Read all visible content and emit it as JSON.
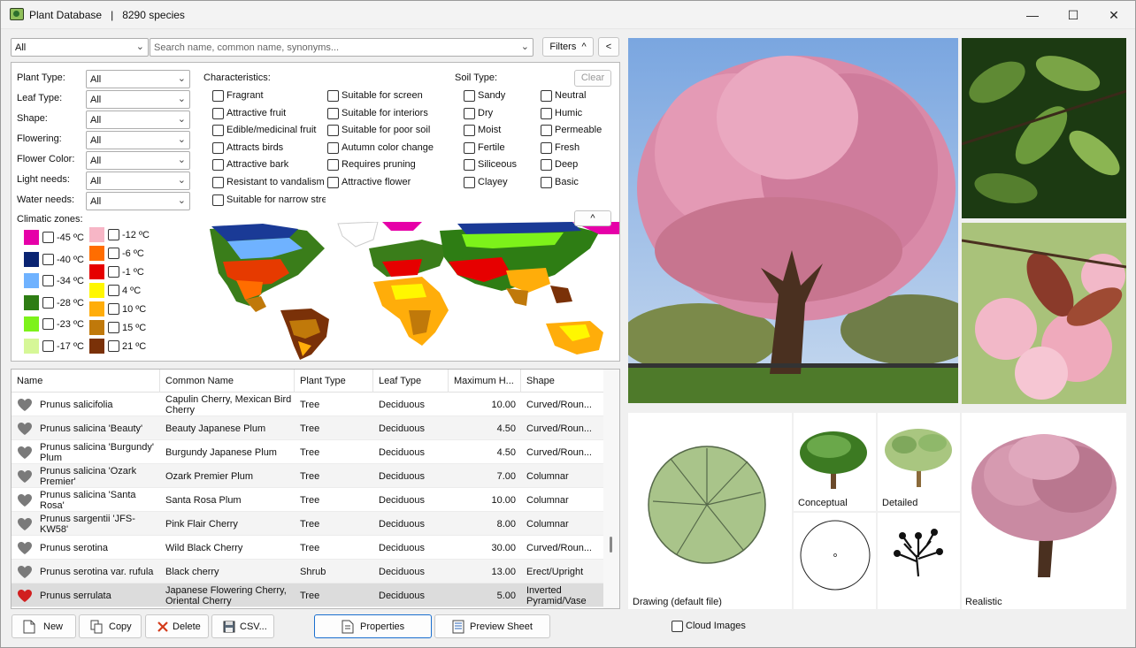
{
  "window": {
    "title": "Plant Database",
    "species_count": "8290 species",
    "minimize": "—",
    "maximize": "☐",
    "close": "✕"
  },
  "topbar": {
    "category_value": "All",
    "search_placeholder": "Search name, common name, synonyms...",
    "filters_label": "Filters",
    "filters_chevron": "^",
    "collapse_label": "<"
  },
  "filters": {
    "fields": [
      {
        "label": "Plant Type:",
        "value": "All"
      },
      {
        "label": "Leaf Type:",
        "value": "All"
      },
      {
        "label": "Shape:",
        "value": "All"
      },
      {
        "label": "Flowering:",
        "value": "All"
      },
      {
        "label": "Flower Color:",
        "value": "All"
      },
      {
        "label": "Light needs:",
        "value": "All"
      },
      {
        "label": "Water needs:",
        "value": "All"
      }
    ],
    "characteristics_title": "Characteristics:",
    "characteristics_col1": [
      "Fragrant",
      "Attractive fruit",
      "Edible/medicinal fruit",
      "Attracts birds",
      "Attractive bark",
      "Resistant to vandalism",
      "Suitable for narrow stre"
    ],
    "characteristics_col2": [
      "Suitable for screen",
      "Suitable for interiors",
      "Suitable for poor soil",
      "Autumn color change",
      "Requires pruning",
      "Attractive flower"
    ],
    "soil_title": "Soil Type:",
    "soil_col1": [
      "Sandy",
      "Dry",
      "Moist",
      "Fertile",
      "Siliceous",
      "Clayey"
    ],
    "soil_col2": [
      "Neutral",
      "Humic",
      "Permeable",
      "Fresh",
      "Deep",
      "Basic"
    ],
    "clear_label": "Clear",
    "climatic_title": "Climatic zones:",
    "collapse_map": "^",
    "zones_left": [
      {
        "label": "-45 ºC",
        "color": "#e600a8"
      },
      {
        "label": "-40 ºC",
        "color": "#0a2472"
      },
      {
        "label": "-34 ºC",
        "color": "#6fb2ff"
      },
      {
        "label": "-28 ºC",
        "color": "#2e7d14"
      },
      {
        "label": "-23 ºC",
        "color": "#7df21a"
      },
      {
        "label": "-17 ºC",
        "color": "#d6f797"
      }
    ],
    "zones_right": [
      {
        "label": "-12 ºC",
        "color": "#f7b6c6"
      },
      {
        "label": "-6 ºC",
        "color": "#ff6d00"
      },
      {
        "label": "-1 ºC",
        "color": "#e60000"
      },
      {
        "label": "4 ºC",
        "color": "#fff700"
      },
      {
        "label": "10 ºC",
        "color": "#ffad0a"
      },
      {
        "label": "15 ºC",
        "color": "#c0790a"
      },
      {
        "label": "21 ºC",
        "color": "#7a3108"
      }
    ]
  },
  "table": {
    "columns": [
      "Name",
      "Common Name",
      "Plant Type",
      "Leaf Type",
      "Maximum H...",
      "Shape"
    ],
    "rows": [
      {
        "name": "Prunus salicifolia",
        "common": "Capulin Cherry, Mexican Bird Cherry",
        "type": "Tree",
        "leaf": "Deciduous",
        "height": "10.00",
        "shape": "Curved/Roun...",
        "favorite": false
      },
      {
        "name": "Prunus salicina 'Beauty'",
        "common": "Beauty Japanese Plum",
        "type": "Tree",
        "leaf": "Deciduous",
        "height": "4.50",
        "shape": "Curved/Roun...",
        "favorite": false
      },
      {
        "name": "Prunus salicina 'Burgundy' Plum",
        "common": "Burgundy Japanese Plum",
        "type": "Tree",
        "leaf": "Deciduous",
        "height": "4.50",
        "shape": "Curved/Roun...",
        "favorite": false
      },
      {
        "name": "Prunus salicina 'Ozark Premier'",
        "common": "Ozark Premier Plum",
        "type": "Tree",
        "leaf": "Deciduous",
        "height": "7.00",
        "shape": "Columnar",
        "favorite": false
      },
      {
        "name": "Prunus salicina 'Santa Rosa'",
        "common": "Santa Rosa Plum",
        "type": "Tree",
        "leaf": "Deciduous",
        "height": "10.00",
        "shape": "Columnar",
        "favorite": false
      },
      {
        "name": "Prunus sargentii 'JFS-KW58'",
        "common": "Pink Flair Cherry",
        "type": "Tree",
        "leaf": "Deciduous",
        "height": "8.00",
        "shape": "Columnar",
        "favorite": false
      },
      {
        "name": "Prunus serotina",
        "common": "Wild Black Cherry",
        "type": "Tree",
        "leaf": "Deciduous",
        "height": "30.00",
        "shape": "Curved/Roun...",
        "favorite": false
      },
      {
        "name": "Prunus serotina var. rufula",
        "common": "Black cherry",
        "type": "Shrub",
        "leaf": "Deciduous",
        "height": "13.00",
        "shape": "Erect/Upright",
        "favorite": false
      },
      {
        "name": "Prunus serrulata",
        "common": "Japanese Flowering Cherry, Oriental Cherry",
        "type": "Tree",
        "leaf": "Deciduous",
        "height": "5.00",
        "shape": "Inverted Pyramid/Vase",
        "favorite": true
      }
    ]
  },
  "buttons": {
    "new": "New",
    "copy": "Copy",
    "delete": "Delete",
    "csv": "CSV...",
    "properties": "Properties",
    "preview": "Preview Sheet"
  },
  "gallery": {
    "drawing_caption": "Drawing   (default file)",
    "conceptual_caption": "Conceptual",
    "detailed_caption": "Detailed",
    "realistic_caption": "Realistic",
    "cloud_images_label": "Cloud Images"
  },
  "colors": {
    "heart_gray": "#7a7a7a",
    "heart_red": "#d11f1f",
    "selected_row": "#dcdcdc"
  }
}
